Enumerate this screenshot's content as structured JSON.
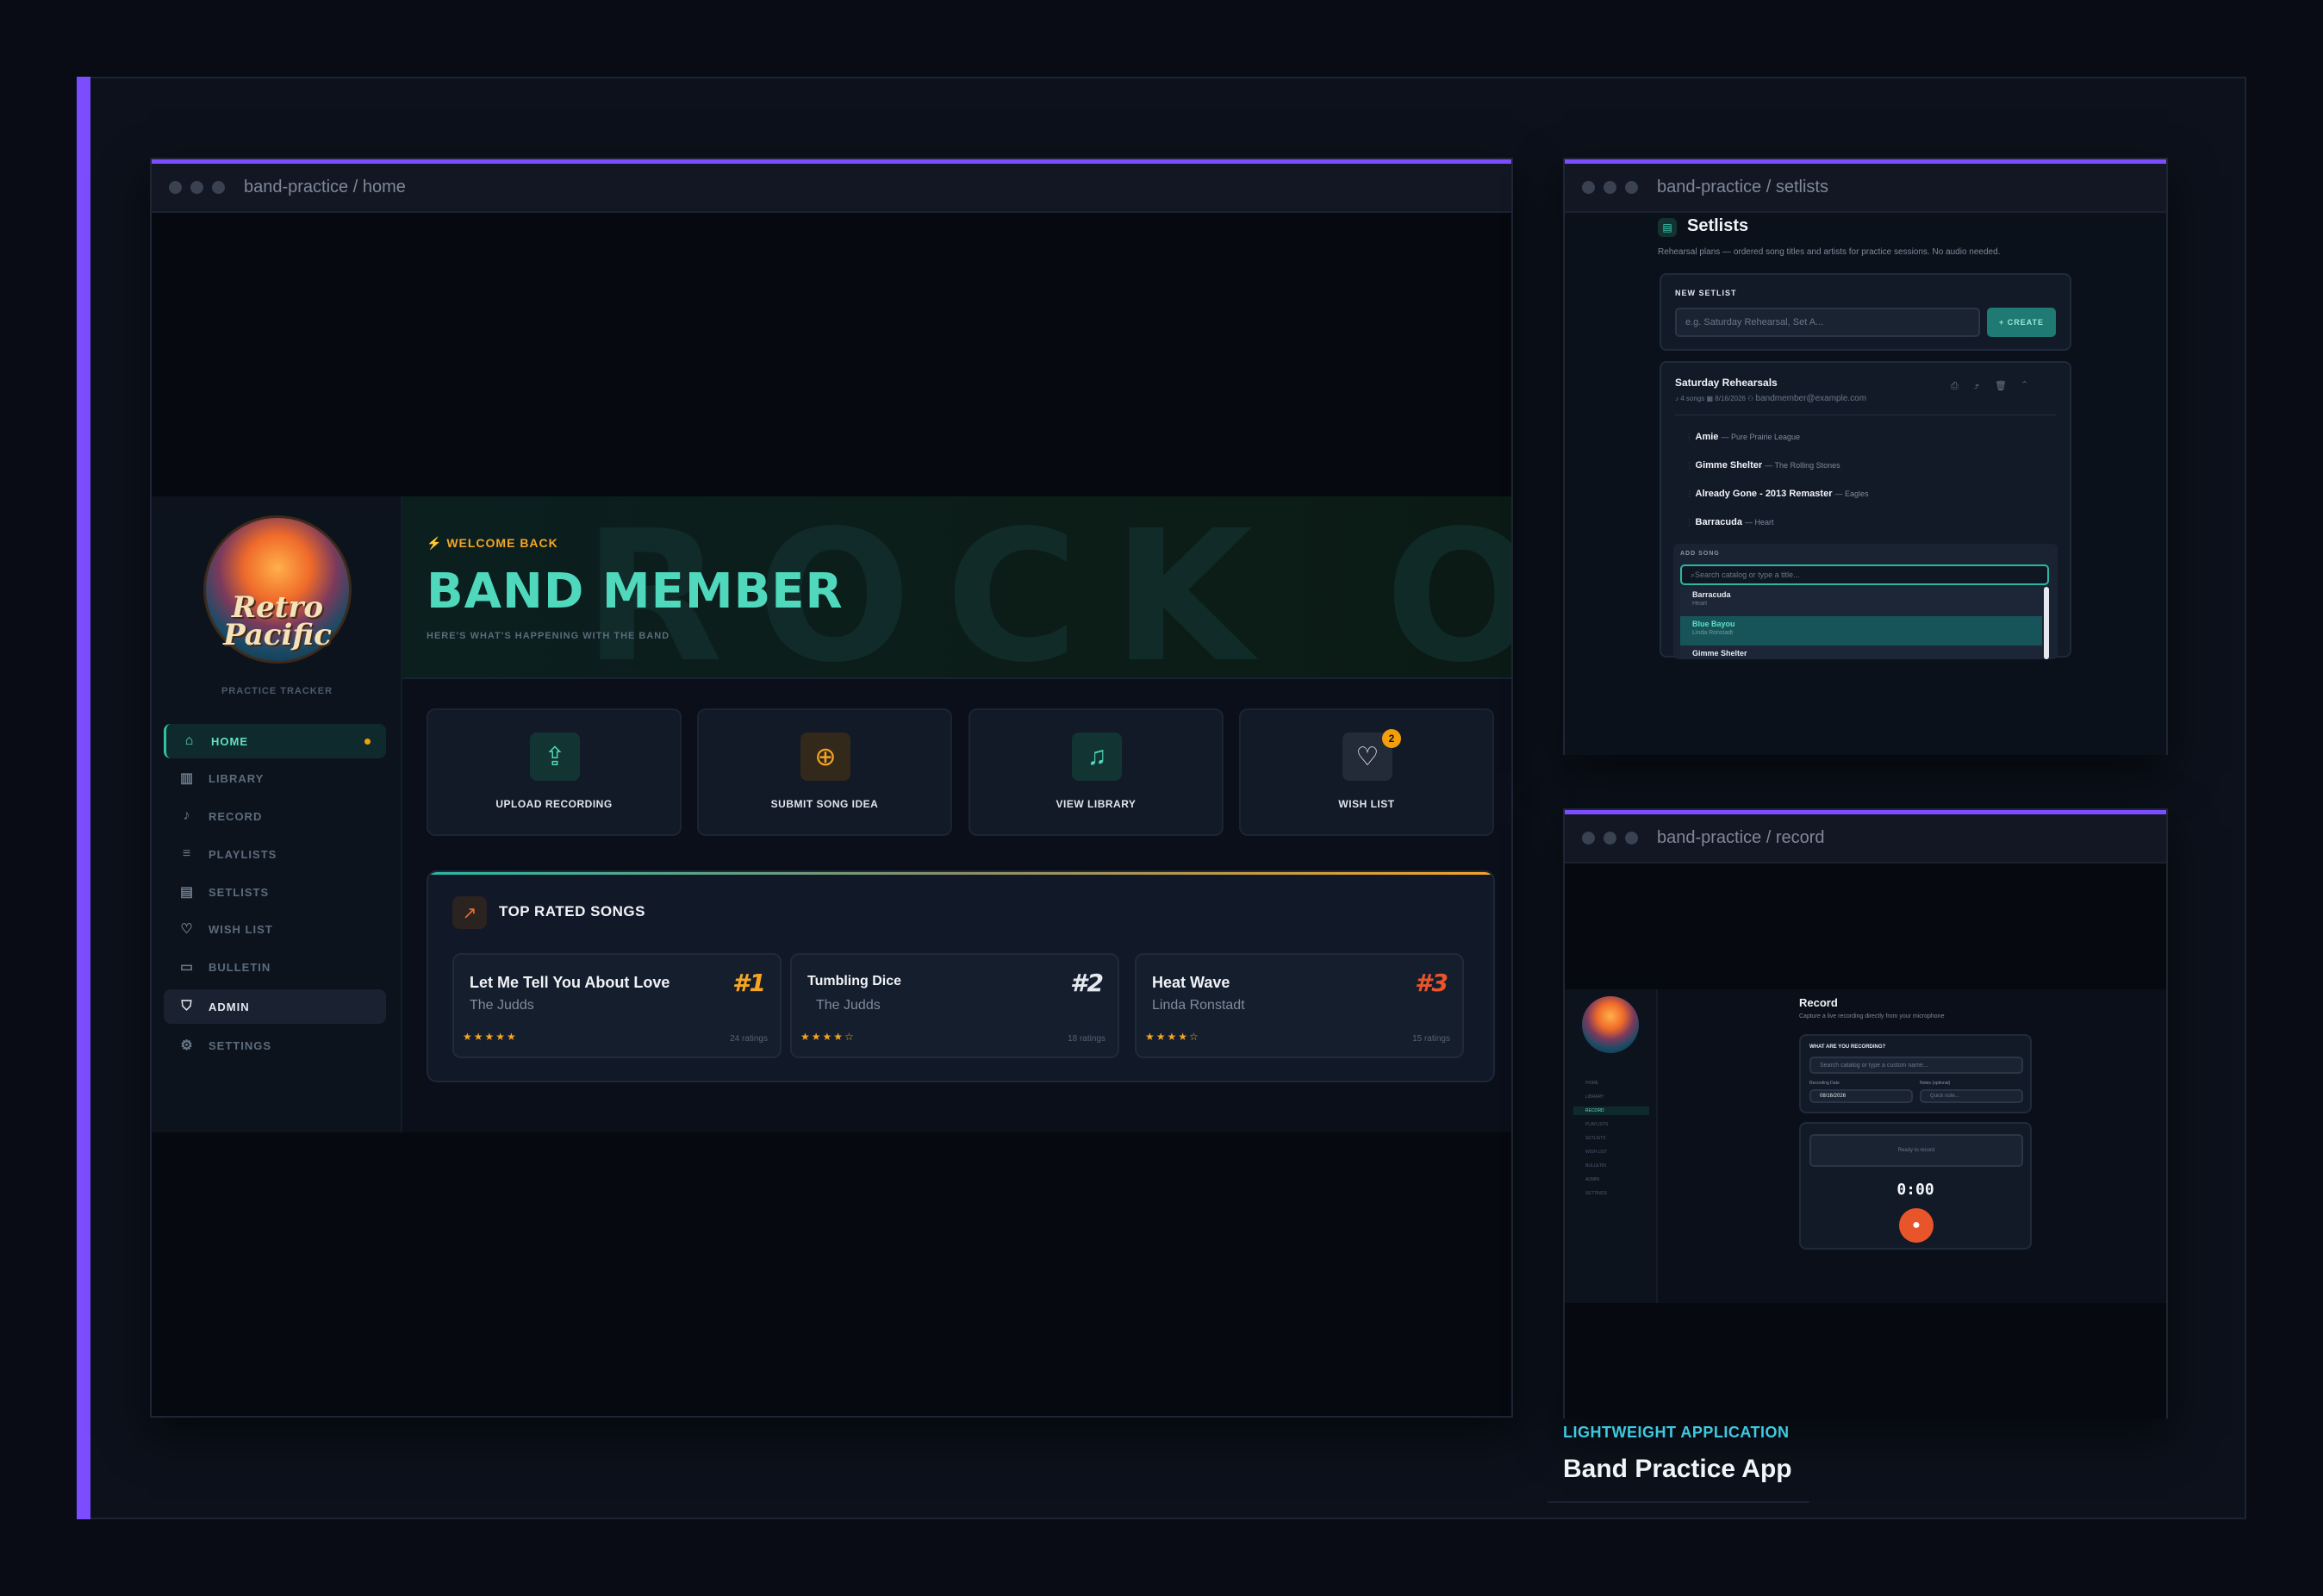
{
  "home_window": {
    "title": "band-practice / home",
    "logo_text_1": "Retro",
    "logo_text_2": "Pacific",
    "logo_sub": "PRACTICE TRACKER",
    "nav": [
      {
        "label": "HOME",
        "icon": "home-icon"
      },
      {
        "label": "LIBRARY",
        "icon": "library-icon"
      },
      {
        "label": "RECORD",
        "icon": "mic-icon"
      },
      {
        "label": "PLAYLISTS",
        "icon": "playlist-icon"
      },
      {
        "label": "SETLISTS",
        "icon": "clipboard-icon"
      },
      {
        "label": "WISH LIST",
        "icon": "heart-icon"
      },
      {
        "label": "BULLETIN",
        "icon": "message-icon"
      },
      {
        "label": "ADMIN",
        "icon": "shield-icon"
      },
      {
        "label": "SETTINGS",
        "icon": "gear-icon"
      }
    ],
    "hero": {
      "kicker": "WELCOME BACK",
      "title": "BAND MEMBER",
      "subtitle": "HERE'S WHAT'S HAPPENING WITH THE BAND",
      "watermark": "ROCK ON"
    },
    "actions": [
      {
        "label": "UPLOAD RECORDING",
        "icon": "upload-icon"
      },
      {
        "label": "SUBMIT SONG IDEA",
        "icon": "plus-circle-icon"
      },
      {
        "label": "VIEW LIBRARY",
        "icon": "music-note-icon"
      },
      {
        "label": "WISH LIST",
        "icon": "heart-icon",
        "badge": "2"
      }
    ],
    "top_rated": {
      "title": "TOP RATED SONGS",
      "songs": [
        {
          "title": "Let Me Tell You About Love",
          "artist": "The Judds",
          "rank": "#1",
          "stars": "★★★★★",
          "ratings": "24 ratings"
        },
        {
          "title": "Tumbling Dice",
          "artist": "The Judds",
          "rank": "#2",
          "stars": "★★★★☆",
          "ratings": "18 ratings"
        },
        {
          "title": "Heat Wave",
          "artist": "Linda Ronstadt",
          "rank": "#3",
          "stars": "★★★★☆",
          "ratings": "15 ratings"
        }
      ]
    }
  },
  "setlists_window": {
    "title": "band-practice / setlists",
    "heading": "Setlists",
    "description": "Rehearsal plans — ordered song titles and artists for practice sessions. No audio needed.",
    "new_setlist_label": "NEW SETLIST",
    "new_setlist_placeholder": "e.g. Saturday Rehearsal, Set A...",
    "create_label": "+ CREATE",
    "setlist": {
      "name": "Saturday Rehearsals",
      "songs_count": "4 songs",
      "date": "8/16/2026",
      "owner": "bandmember@example.com",
      "songs": [
        {
          "title": "Amie",
          "artist": "— Pure Prairie League"
        },
        {
          "title": "Gimme Shelter",
          "artist": "— The Rolling Stones"
        },
        {
          "title": "Already Gone - 2013 Remaster",
          "artist": "— Eagles"
        },
        {
          "title": "Barracuda",
          "artist": "— Heart"
        }
      ],
      "add_song_label": "ADD SONG",
      "search_placeholder": "Search catalog or type a title...",
      "results": [
        {
          "title": "Barracuda",
          "artist": "Heart"
        },
        {
          "title": "Blue Bayou",
          "artist": "Linda Ronstadt"
        },
        {
          "title": "Gimme Shelter",
          "artist": ""
        }
      ]
    }
  },
  "record_window": {
    "title": "band-practice / record",
    "heading": "Record",
    "description": "Capture a live recording directly from your microphone",
    "question": "WHAT ARE YOU RECORDING?",
    "search_placeholder": "Search catalog or type a custom name...",
    "date_label": "Recording Date",
    "date_value": "08/16/2026",
    "notes_label": "Notes (optional)",
    "notes_placeholder": "Quick note...",
    "ready_label": "Ready to record",
    "timer": "0:00"
  },
  "footer": {
    "kicker": "LIGHTWEIGHT APPLICATION",
    "title": "Band Practice App"
  },
  "colors": {
    "accent": "#7c4dff",
    "teal": "#4fd8bb",
    "orange": "#f5a524",
    "red": "#e8552b"
  }
}
